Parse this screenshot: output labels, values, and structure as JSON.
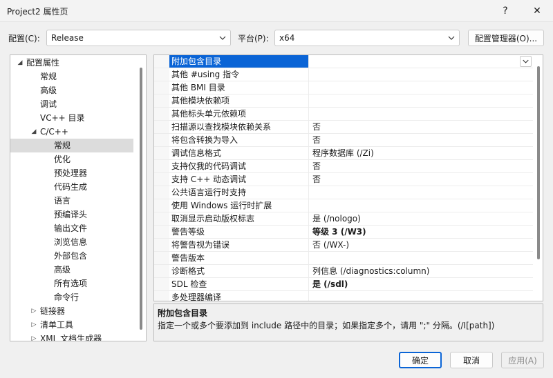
{
  "window": {
    "title": "Project2 属性页",
    "help_label": "?",
    "close_label": "✕"
  },
  "toolbar": {
    "config_label": "配置(C):",
    "config_value": "Release",
    "platform_label": "平台(P):",
    "platform_value": "x64",
    "config_manager_label": "配置管理器(O)..."
  },
  "tree": {
    "items": [
      {
        "label": "配置属性",
        "level": 0,
        "expander": "down"
      },
      {
        "label": "常规",
        "level": 1,
        "expander": ""
      },
      {
        "label": "高级",
        "level": 1,
        "expander": ""
      },
      {
        "label": "调试",
        "level": 1,
        "expander": ""
      },
      {
        "label": "VC++ 目录",
        "level": 1,
        "expander": ""
      },
      {
        "label": "C/C++",
        "level": 1,
        "expander": "down"
      },
      {
        "label": "常规",
        "level": 2,
        "expander": "",
        "selected": true
      },
      {
        "label": "优化",
        "level": 2,
        "expander": ""
      },
      {
        "label": "预处理器",
        "level": 2,
        "expander": ""
      },
      {
        "label": "代码生成",
        "level": 2,
        "expander": ""
      },
      {
        "label": "语言",
        "level": 2,
        "expander": ""
      },
      {
        "label": "预编译头",
        "level": 2,
        "expander": ""
      },
      {
        "label": "输出文件",
        "level": 2,
        "expander": ""
      },
      {
        "label": "浏览信息",
        "level": 2,
        "expander": ""
      },
      {
        "label": "外部包含",
        "level": 2,
        "expander": ""
      },
      {
        "label": "高级",
        "level": 2,
        "expander": ""
      },
      {
        "label": "所有选项",
        "level": 2,
        "expander": ""
      },
      {
        "label": "命令行",
        "level": 2,
        "expander": ""
      },
      {
        "label": "链接器",
        "level": 1,
        "expander": "right"
      },
      {
        "label": "清单工具",
        "level": 1,
        "expander": "right"
      },
      {
        "label": "XML 文档生成器",
        "level": 1,
        "expander": "right"
      }
    ]
  },
  "grid": {
    "rows": [
      {
        "name": "附加包含目录",
        "value": "",
        "selected": true
      },
      {
        "name": "其他 #using 指令",
        "value": ""
      },
      {
        "name": "其他 BMI 目录",
        "value": ""
      },
      {
        "name": "其他模块依赖项",
        "value": ""
      },
      {
        "name": "其他标头单元依赖项",
        "value": ""
      },
      {
        "name": "扫描源以查找模块依赖关系",
        "value": "否"
      },
      {
        "name": "将包含转换为导入",
        "value": "否"
      },
      {
        "name": "调试信息格式",
        "value": "程序数据库 (/Zi)"
      },
      {
        "name": "支持仅我的代码调试",
        "value": "否"
      },
      {
        "name": "支持 C++ 动态调试",
        "value": "否"
      },
      {
        "name": "公共语言运行时支持",
        "value": ""
      },
      {
        "name": "使用 Windows 运行时扩展",
        "value": ""
      },
      {
        "name": "取消显示启动版权标志",
        "value": "是 (/nologo)"
      },
      {
        "name": "警告等级",
        "value": "等级 3 (/W3)",
        "bold": true
      },
      {
        "name": "将警告视为错误",
        "value": "否 (/WX-)"
      },
      {
        "name": "警告版本",
        "value": ""
      },
      {
        "name": "诊断格式",
        "value": "列信息 (/diagnostics:column)"
      },
      {
        "name": "SDL 检查",
        "value": "是 (/sdl)",
        "bold": true
      },
      {
        "name": "多处理器编译",
        "value": ""
      }
    ]
  },
  "description": {
    "title": "附加包含目录",
    "text": "指定一个或多个要添加到 include 路径中的目录；如果指定多个，请用 \";\" 分隔。(/I[path])"
  },
  "buttons": {
    "ok": "确定",
    "cancel": "取消",
    "apply": "应用(A)"
  },
  "colors": {
    "accent": "#0a64d6",
    "selected_tree": "#dcdcdc"
  }
}
